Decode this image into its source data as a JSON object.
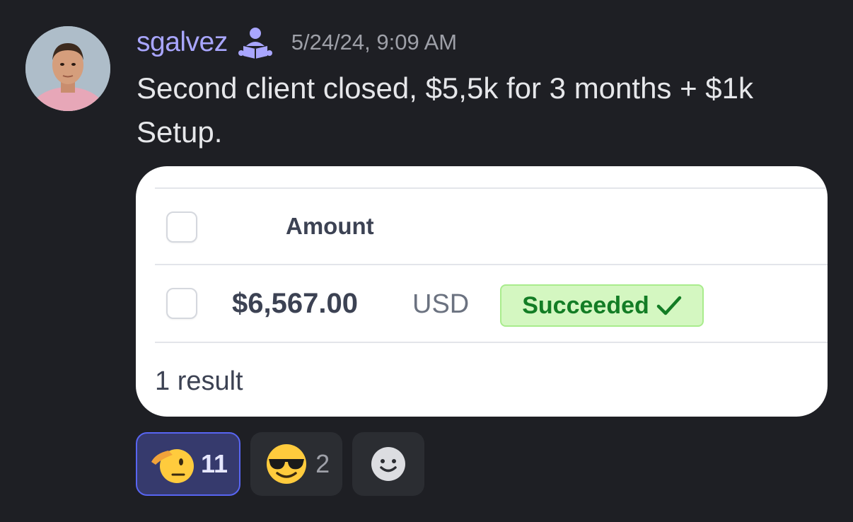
{
  "message": {
    "username": "sgalvez",
    "role_icon": "reader-role-icon",
    "timestamp": "5/24/24, 9:09 AM",
    "text": "Second client closed, $5,5k for 3 months + $1k Setup."
  },
  "payment_table": {
    "column_header": "Amount",
    "row": {
      "amount": "$6,567.00",
      "currency": "USD",
      "status": "Succeeded"
    },
    "results_text": "1 result"
  },
  "reactions": [
    {
      "emoji": "saluting-face",
      "count": "11",
      "selected": true
    },
    {
      "emoji": "smiling-face-with-sunglasses",
      "count": "2",
      "selected": false
    }
  ],
  "add_reaction_icon": "add-reaction-icon",
  "colors": {
    "background": "#1e1f24",
    "username": "#a9a6ff",
    "status_green": "#137d25",
    "reaction_selected": "#5865f2"
  }
}
